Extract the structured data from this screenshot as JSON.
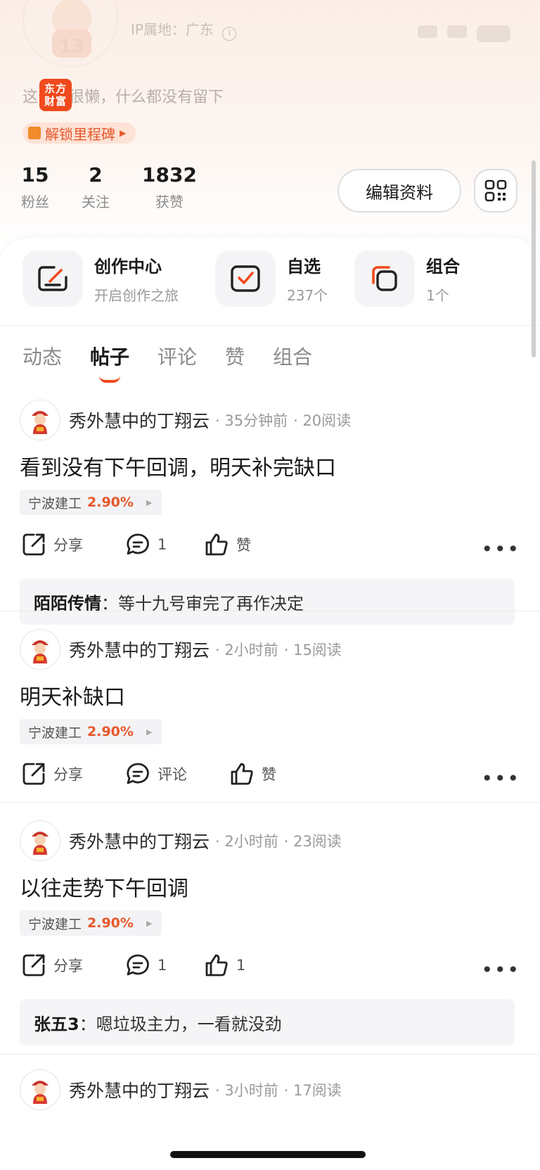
{
  "profile": {
    "ip_label": "IP属地：广东",
    "bio": "这个人很懒，什么都没有留下",
    "app_badge": "东方财富",
    "milestone": "解锁里程碑"
  },
  "stats": [
    {
      "value": "15",
      "label": "粉丝"
    },
    {
      "value": "2",
      "label": "关注"
    },
    {
      "value": "1832",
      "label": "获赞"
    }
  ],
  "edit_label": "编辑资料",
  "quick": [
    {
      "title": "创作中心",
      "sub": "开启创作之旅"
    },
    {
      "title": "自选",
      "sub": "237个"
    },
    {
      "title": "组合",
      "sub": "1个"
    }
  ],
  "tabs": [
    "动态",
    "帖子",
    "评论",
    "赞",
    "组合"
  ],
  "posts": [
    {
      "author": "秀外慧中的丁翔云",
      "time": "· 35分钟前",
      "reads": "· 20阅读",
      "title": "看到没有下午回调，明天补完缺口",
      "stock": "宁波建工",
      "pct": "2.90%",
      "share": "分享",
      "comment": "1",
      "like": "赞",
      "reply_user": "陌陌传情",
      "reply_text": "：等十九号审完了再作决定"
    },
    {
      "author": "秀外慧中的丁翔云",
      "time": "· 2小时前",
      "reads": "· 15阅读",
      "title": "明天补缺口",
      "stock": "宁波建工",
      "pct": "2.90%",
      "share": "分享",
      "comment": "评论",
      "like": "赞"
    },
    {
      "author": "秀外慧中的丁翔云",
      "time": "· 2小时前",
      "reads": "· 23阅读",
      "title": "以往走势下午回调",
      "stock": "宁波建工",
      "pct": "2.90%",
      "share": "分享",
      "comment": "1",
      "like": "1",
      "reply_user": "张五3",
      "reply_text": "：嗯垃圾主力，一看就没劲"
    },
    {
      "author": "秀外慧中的丁翔云",
      "time": "· 3小时前",
      "reads": "· 17阅读"
    }
  ]
}
